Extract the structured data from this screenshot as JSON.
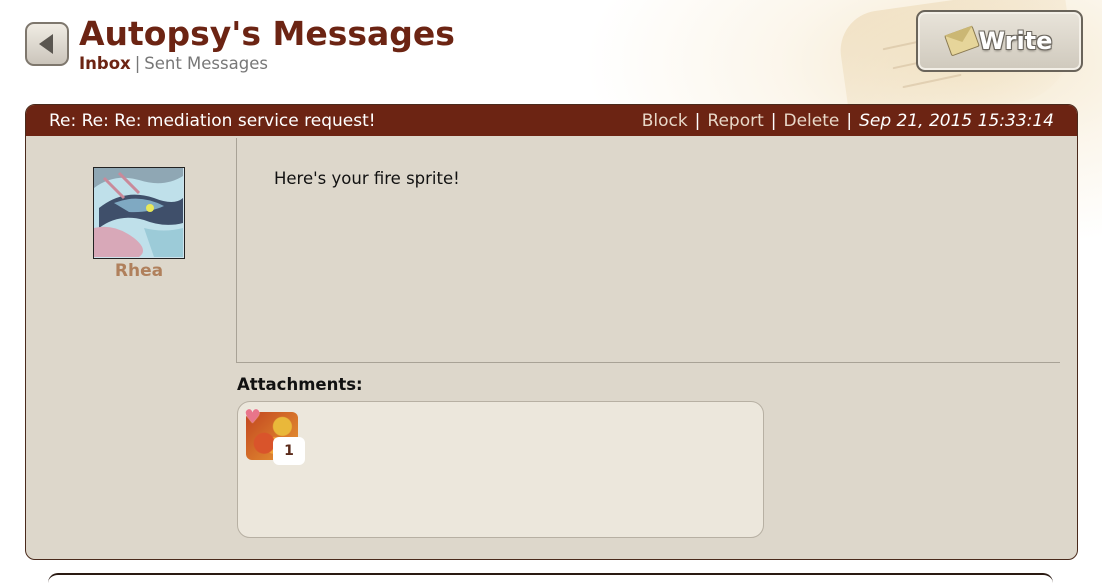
{
  "header": {
    "title": "Autopsy's Messages",
    "tabs": {
      "inbox": "Inbox",
      "separator": "|",
      "sent": "Sent Messages"
    },
    "write_label": "Write"
  },
  "message": {
    "subject": "Re: Re: Re: mediation service request!",
    "actions": {
      "block": "Block",
      "report": "Report",
      "delete": "Delete"
    },
    "separator": "|",
    "date": "Sep 21, 2015 15:33:14",
    "sender": {
      "name": "Rhea"
    },
    "body": "Here's your fire sprite!",
    "attachments_label": "Attachments:",
    "attachments": [
      {
        "icon": "fire-sprite-icon",
        "quantity": "1"
      }
    ]
  },
  "colors": {
    "header_bar": "#6c2413",
    "panel_bg": "#ddd7cb",
    "title": "#6c2413",
    "sender_name": "#b0805c",
    "attachment_bg": "#ece7dc"
  }
}
